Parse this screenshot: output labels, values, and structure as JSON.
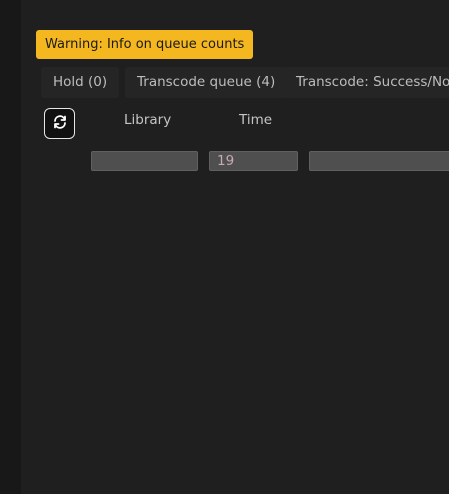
{
  "warning": {
    "text": "Warning: Info on queue counts"
  },
  "tabs": [
    {
      "label": "Hold (0)"
    },
    {
      "label": "Transcode queue (4)"
    },
    {
      "label": "Transcode: Success/Not r"
    }
  ],
  "table": {
    "columns": [
      "Library",
      "Time"
    ],
    "filters": {
      "library": "",
      "time": "19",
      "extra": ""
    }
  },
  "icons": {
    "refresh": "refresh-icon"
  },
  "colors": {
    "warning_bg": "#f5b71f",
    "background": "#1f1f1f"
  }
}
